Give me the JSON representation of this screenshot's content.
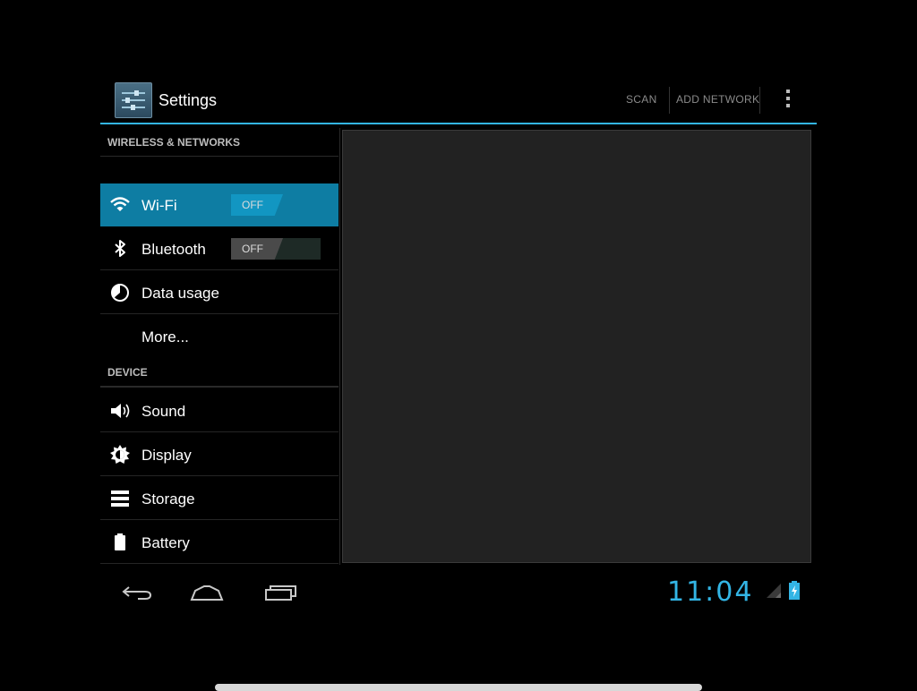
{
  "action_bar": {
    "title": "Settings",
    "actions": [
      "SCAN",
      "ADD NETWORK"
    ],
    "app_icon": "settings-sliders-icon",
    "overflow_icon": "overflow-menu-icon",
    "accent_color": "#33b5e5"
  },
  "sections": [
    {
      "header": "WIRELESS & NETWORKS",
      "items": [
        {
          "label": "Wi-Fi",
          "icon": "wifi-icon",
          "toggle": "OFF",
          "selected": true
        },
        {
          "label": "Bluetooth",
          "icon": "bluetooth-icon",
          "toggle": "OFF"
        },
        {
          "label": "Data usage",
          "icon": "data-usage-icon"
        },
        {
          "label": "More..."
        }
      ]
    },
    {
      "header": "DEVICE",
      "items": [
        {
          "label": "Sound",
          "icon": "sound-icon"
        },
        {
          "label": "Display",
          "icon": "display-icon"
        },
        {
          "label": "Storage",
          "icon": "storage-icon"
        },
        {
          "label": "Battery",
          "icon": "battery-icon"
        }
      ]
    }
  ],
  "nav_bar": {
    "back_icon": "back-icon",
    "home_icon": "home-icon",
    "recents_icon": "recent-apps-icon"
  },
  "status_bar": {
    "clock": "11:04",
    "signal_icon": "signal-icon",
    "battery_icon": "battery-charging-icon"
  },
  "colors": {
    "selected_item": "#0e7da3",
    "clock": "#33b5e5"
  }
}
